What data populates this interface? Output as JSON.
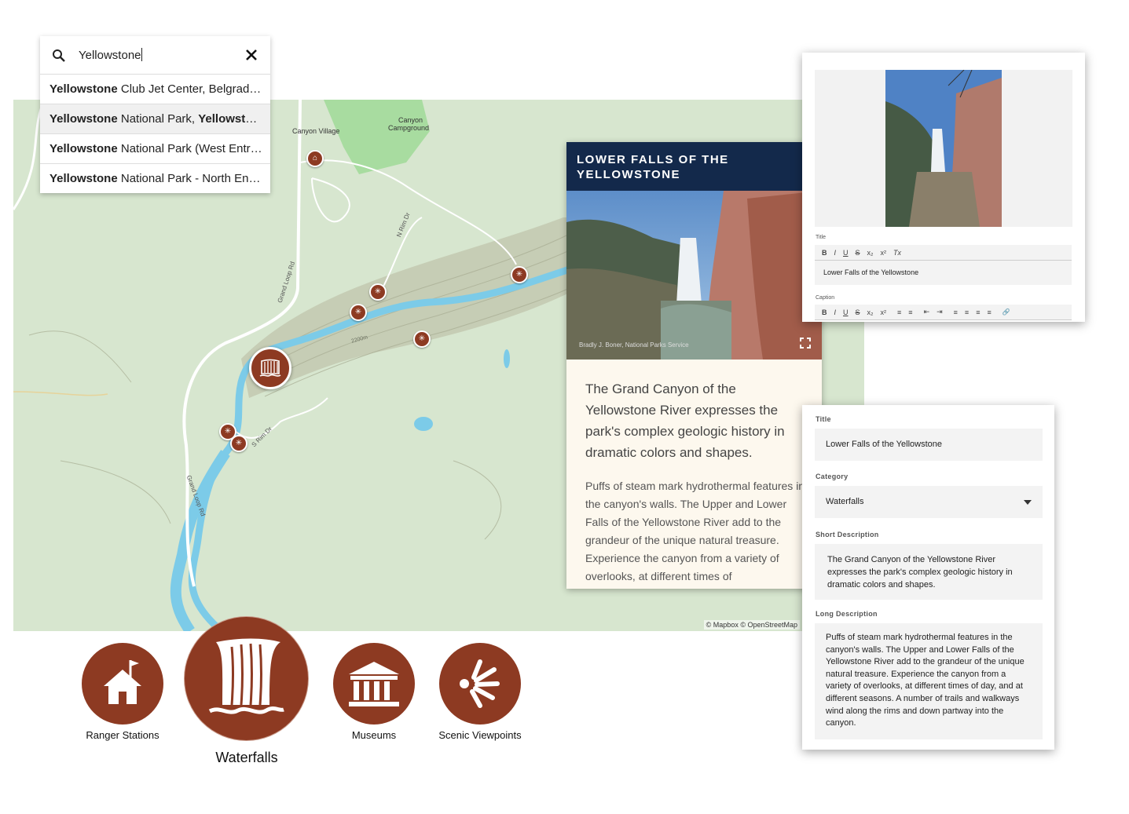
{
  "search": {
    "query": "Yellowstone",
    "results": [
      {
        "match": "Yellowstone",
        "rest": " Club Jet Center, Belgrade, Montana",
        "match2": ""
      },
      {
        "match": "Yellowstone",
        "rest": " National Park, ",
        "match2": "Yellowstone National Park"
      },
      {
        "match": "Yellowstone",
        "rest": " National Park (West Entrance), West Yellowstone",
        "match2": ""
      },
      {
        "match": "Yellowstone",
        "rest": " National Park - North Entrance, Gardiner",
        "match2": ""
      }
    ]
  },
  "map": {
    "labels": {
      "canyon_village": "Canyon Village",
      "canyon_campground_1": "Canyon",
      "canyon_campground_2": "Campground",
      "n_rim_dr": "N Rim Dr",
      "s_rim_dr": "S Rim Dr",
      "grand_loop_rd_1": "Grand Loop Rd",
      "grand_loop_rd_2": "Grand Loop Rd",
      "elev": "2200m"
    },
    "attribution": "© Mapbox © OpenStreetMap",
    "colors": {
      "land": "#d7e6cf",
      "water": "#7ccbe8",
      "marker": "#8d3a22",
      "park": "#a8dca0"
    }
  },
  "popup": {
    "title_line1": "LOWER FALLS OF THE",
    "title_line2": "YELLOWSTONE",
    "photo_credit": "Bradly J. Boner, National Parks Service",
    "short_description": "The Grand Canyon of the Yellowstone River expresses the park's complex geologic history in dramatic colors and shapes.",
    "long_description": "Puffs of steam mark hydrothermal features in the canyon's walls. The Upper and Lower Falls of the Yellowstone River add to the grandeur of the unique natural treasure. Experience the canyon from a variety of overlooks, at different times of"
  },
  "editor1": {
    "title_label": "Title",
    "title_value": "Lower Falls of the Yellowstone",
    "caption_label": "Caption",
    "toolbar_title": [
      "B",
      "I",
      "U",
      "S",
      "x₂",
      "x²",
      "Tx"
    ],
    "toolbar_caption": [
      "B",
      "I",
      "U",
      "S",
      "x₂",
      "x²",
      "≡",
      "≡",
      "⇤",
      "⇥",
      "≡",
      "≡",
      "≡",
      "≡",
      "🔗"
    ]
  },
  "editor2": {
    "title_label": "Title",
    "title_value": "Lower Falls of the Yellowstone",
    "category_label": "Category",
    "category_value": "Waterfalls",
    "short_label": "Short Description",
    "short_value": "The Grand Canyon of the Yellowstone River expresses the park's complex geologic history in dramatic colors and shapes.",
    "long_label": "Long Description",
    "long_value": "Puffs of steam mark hydrothermal features in the canyon's walls. The Upper and Lower Falls of the Yellowstone River add to the grandeur of the unique natural treasure. Experience the canyon from a variety of overlooks, at different times of day, and at different seasons. A number of trails and walkways wind along the rims and down partway into the canyon."
  },
  "categories": [
    {
      "label": "Ranger Stations",
      "icon": "ranger-station-icon"
    },
    {
      "label": "Waterfalls",
      "icon": "waterfall-icon"
    },
    {
      "label": "Museums",
      "icon": "museum-icon"
    },
    {
      "label": "Scenic Viewpoints",
      "icon": "viewpoint-icon"
    }
  ]
}
